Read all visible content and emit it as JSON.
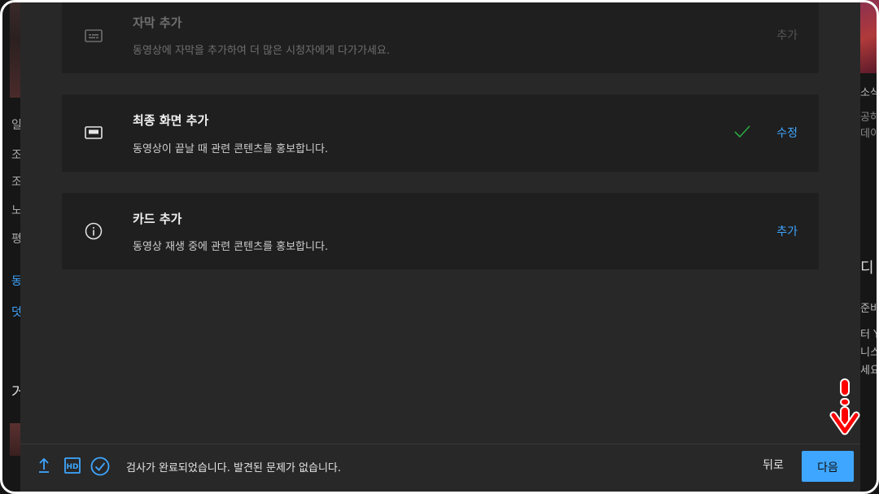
{
  "background": {
    "left_glyphs": [
      "일",
      "조",
      "조",
      "노",
      "평",
      "동",
      "덧",
      "거"
    ],
    "right_lines": [
      "소식",
      "공하",
      "데이",
      "디",
      "준비",
      "터 Y",
      "니스",
      "세요"
    ]
  },
  "cards": [
    {
      "title": "자막 추가",
      "description": "동영상에 자막을 추가하여 더 많은 시청자에게 다가가세요.",
      "action": "추가",
      "icon": "subtitles-icon"
    },
    {
      "title": "최종 화면 추가",
      "description": "동영상이 끝날 때 관련 콘텐츠를 홍보합니다.",
      "action": "수정",
      "icon": "end-screen-icon",
      "completed": true
    },
    {
      "title": "카드 추가",
      "description": "동영상 재생 중에 관련 콘텐츠를 홍보합니다.",
      "action": "추가",
      "icon": "info-icon"
    }
  ],
  "footer": {
    "status_text": "검사가 완료되었습니다. 발견된 문제가 없습니다.",
    "icons": [
      "upload-icon",
      "hd-icon",
      "check-circle-icon"
    ],
    "back_label": "뒤로",
    "next_label": "다음"
  },
  "colors": {
    "accent": "#3ea6ff",
    "dialog_bg": "#282828",
    "card_bg": "#1f1f1f",
    "check": "#2ba640",
    "annotation": "#ff0000"
  }
}
